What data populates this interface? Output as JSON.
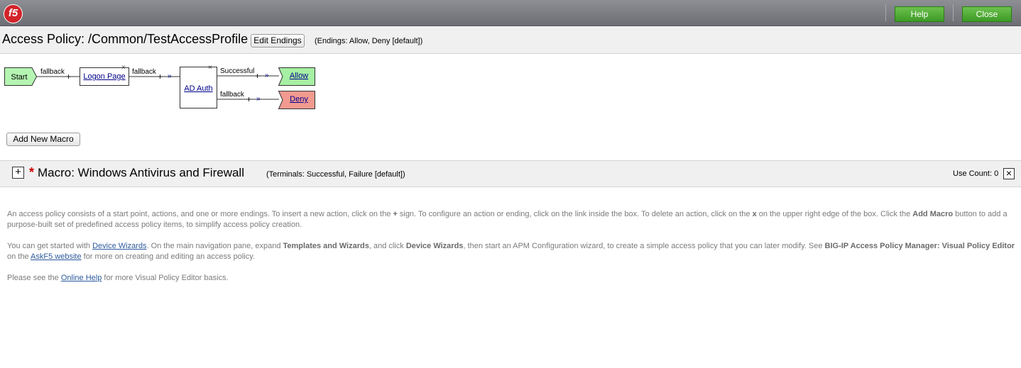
{
  "topbar": {
    "logo_text": "f5",
    "help_label": "Help",
    "close_label": "Close"
  },
  "header": {
    "title": "Access Policy: /Common/TestAccessProfile",
    "edit_endings_label": "Edit Endings",
    "endings_note": "(Endings: Allow, Deny [default])"
  },
  "policy": {
    "start_label": "Start",
    "logon_page_label": "Logon Page",
    "ad_auth_label": "AD Auth",
    "allow_label": "Allow",
    "deny_label": "Deny",
    "branch_fallback": "fallback",
    "branch_successful": "Successful",
    "plus": "+",
    "close_glyph": "×",
    "arrow_glyph": "»"
  },
  "add_macro_label": "Add New Macro",
  "macro": {
    "expand_glyph": "+",
    "asterisk": "*",
    "title": "Macro: Windows Antivirus and Firewall",
    "terminals": "(Terminals: Successful, Failure [default])",
    "use_count": "Use Count: 0",
    "close_glyph": "×"
  },
  "help": {
    "p1_a": "An access policy consists of a start point, actions, and one or more endings. To insert a new action, click on the ",
    "p1_plus": "+",
    "p1_b": " sign. To configure an action or ending, click on the link inside the box. To delete an action, click on the ",
    "p1_x": "x",
    "p1_c": " on the upper right edge of the box. Click the ",
    "p1_add_macro": "Add Macro",
    "p1_d": " button to add a purpose-built set of predefined access policy items, to simplify access policy creation.",
    "p2_a": "You can get started with ",
    "p2_link_wizards": "Device Wizards",
    "p2_b": ". On the main navigation pane, expand ",
    "p2_templates": "Templates and Wizards",
    "p2_c": ", and click ",
    "p2_device_wizards": "Device Wizards",
    "p2_d": ", then start an APM Configuration wizard, to create a simple access policy that you can later modify. See ",
    "p2_bigip": "BIG-IP Access Policy Manager: Visual Policy Editor",
    "p2_e": " on the ",
    "p2_link_askf5": "AskF5 website",
    "p2_f": " for more on creating and editing an access policy.",
    "p3_a": "Please see the ",
    "p3_link_help": "Online Help",
    "p3_b": " for more Visual Policy Editor basics."
  },
  "colors": {
    "start_green": "#b5f5b2",
    "allow_green": "#a6f0a3",
    "deny_red": "#f39a90",
    "button_green": "#4aaa2e",
    "macro_asterisk": "#cc0000"
  }
}
